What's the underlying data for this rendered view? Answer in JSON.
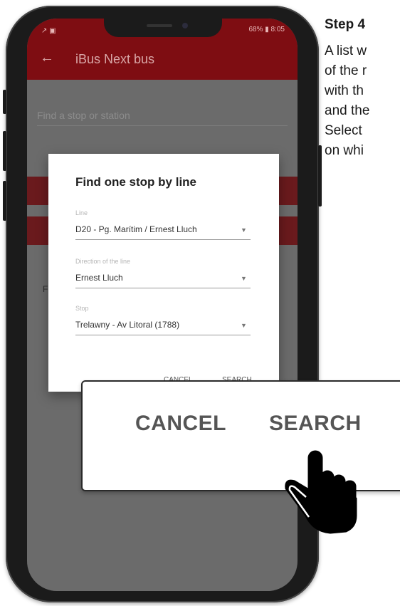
{
  "instructions": {
    "step_title": "Step 4",
    "lines": [
      "A list w",
      "of the r",
      "with th",
      "and the",
      "Select",
      "on whi"
    ]
  },
  "status_bar": {
    "left": "↗ ▣",
    "right": "68% ▮ 8:05"
  },
  "app_bar": {
    "back_icon": "arrow-back-icon",
    "title": "iBus Next bus"
  },
  "background": {
    "search_hint": "Find a stop or station",
    "stub_letter": "F"
  },
  "dialog": {
    "title": "Find one stop by line",
    "fields": [
      {
        "label": "Line",
        "value": "D20 - Pg. Marítim / Ernest Lluch"
      },
      {
        "label": "Direction of the line",
        "value": "Ernest Lluch"
      },
      {
        "label": "Stop",
        "value": "Trelawny - Av Litoral (1788)"
      }
    ],
    "cancel": "CANCEL",
    "search": "SEARCH"
  },
  "callout": {
    "cancel": "CANCEL",
    "search": "SEARCH",
    "pointer_icon": "hand-pointer-icon"
  },
  "colors": {
    "app_bar": "#7e0d12",
    "dimmed_background": "#6b6b6b"
  }
}
